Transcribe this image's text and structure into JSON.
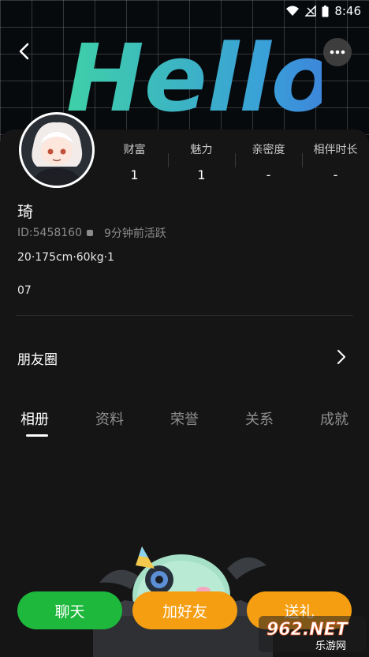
{
  "status_bar": {
    "time": "8:46"
  },
  "profile": {
    "nickname": "琦",
    "id": "ID:5458160",
    "active_status": "9分钟前活跃",
    "body_info": "20·175cm·60kg·1",
    "signature": "07"
  },
  "stats": [
    {
      "label": "财富",
      "value": "1"
    },
    {
      "label": "魅力",
      "value": "1"
    },
    {
      "label": "亲密度",
      "value": "-"
    },
    {
      "label": "相伴时长",
      "value": "-"
    }
  ],
  "moments": {
    "label": "朋友圈"
  },
  "tabs": [
    {
      "label": "相册",
      "active": true
    },
    {
      "label": "资料",
      "active": false
    },
    {
      "label": "荣誉",
      "active": false
    },
    {
      "label": "关系",
      "active": false
    },
    {
      "label": "成就",
      "active": false
    }
  ],
  "actions": {
    "chat": {
      "label": "聊天",
      "color": "#1db83c"
    },
    "add_friend": {
      "label": "加好友",
      "color": "#f59e12"
    },
    "gift": {
      "label": "送礼",
      "color": "#f59e12"
    }
  },
  "cover_text": "Hello！",
  "watermark": {
    "brand": "962.NET",
    "site": "乐游网"
  },
  "icons": [
    "back-arrow-icon",
    "more-dots-icon",
    "chevron-right-icon",
    "copy-icon",
    "wifi-icon",
    "signal-icon",
    "battery-icon"
  ]
}
